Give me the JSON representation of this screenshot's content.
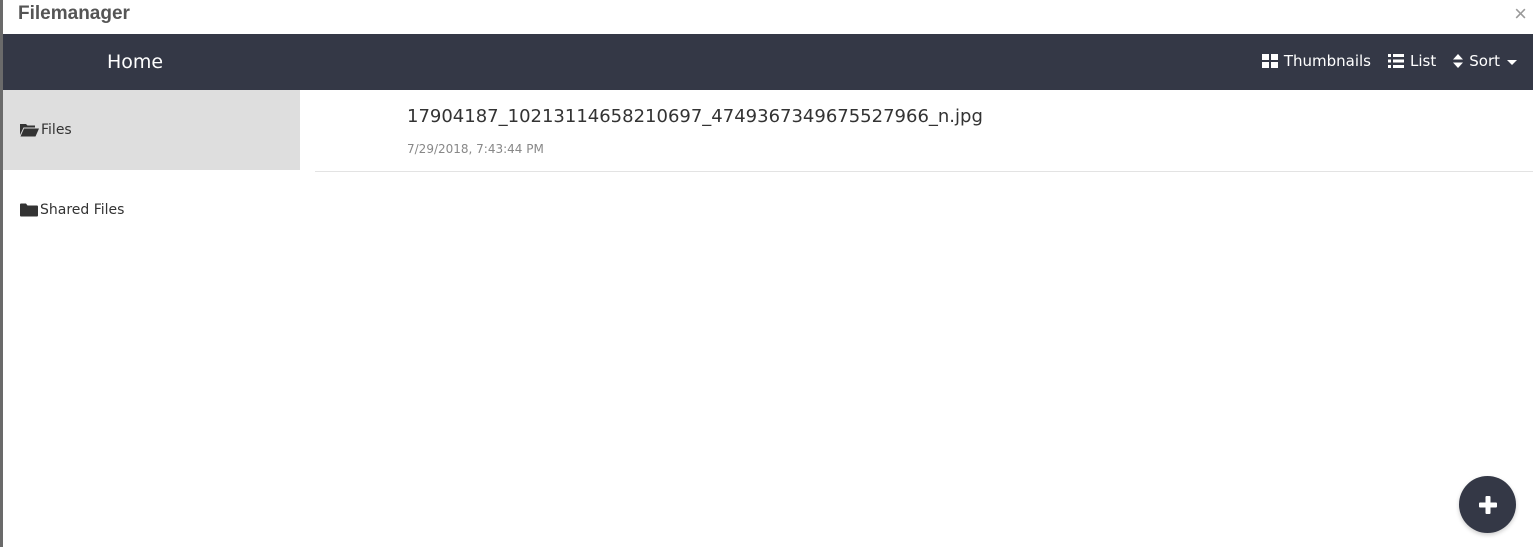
{
  "window": {
    "title": "Filemanager",
    "close_icon": "close-icon"
  },
  "navbar": {
    "home_label": "Home",
    "thumbnails_label": "Thumbnails",
    "list_label": "List",
    "sort_label": "Sort",
    "background": "#343846"
  },
  "sidebar": {
    "items": [
      {
        "label": "Files",
        "icon": "folder-open-icon",
        "active": true
      },
      {
        "label": "Shared Files",
        "icon": "folder-icon",
        "active": false
      }
    ]
  },
  "files": [
    {
      "name": "17904187_10213114658210697_4749367349675527966_n.jpg",
      "date": "7/29/2018, 7:43:44 PM"
    }
  ],
  "fab": {
    "icon": "plus-icon"
  }
}
